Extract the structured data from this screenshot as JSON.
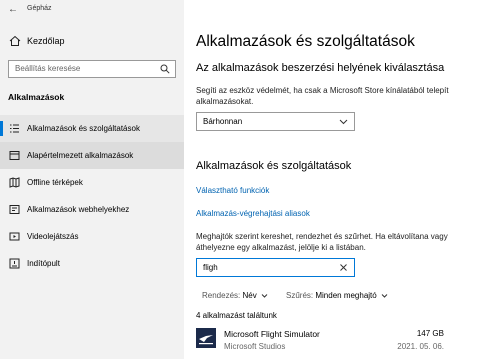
{
  "window": {
    "title": "Gépház"
  },
  "sidebar": {
    "home_label": "Kezdőlap",
    "search_placeholder": "Beállítás keresése",
    "section_label": "Alkalmazások",
    "items": [
      {
        "label": "Alkalmazások és szolgáltatások",
        "icon": "list-icon"
      },
      {
        "label": "Alapértelmezett alkalmazások",
        "icon": "default-apps-icon"
      },
      {
        "label": "Offline térképek",
        "icon": "map-icon"
      },
      {
        "label": "Alkalmazások webhelyekhez",
        "icon": "website-icon"
      },
      {
        "label": "Videolejátszás",
        "icon": "video-icon"
      },
      {
        "label": "Indítópult",
        "icon": "startup-icon"
      }
    ]
  },
  "main": {
    "title": "Alkalmazások és szolgáltatások",
    "install_heading": "Az alkalmazások beszerzési helyének kiválasztása",
    "install_desc": "Segíti az eszköz védelmét, ha csak a Microsoft Store kínálatából telepít alkalmazásokat.",
    "install_dropdown_value": "Bárhonnan",
    "apps_heading": "Alkalmazások és szolgáltatások",
    "link_optional": "Választható funkciók",
    "link_aliases": "Alkalmazás-végrehajtási aliasok",
    "apps_desc": "Meghajtók szerint kereshet, rendezhet és szűrhet. Ha eltávolítana vagy áthelyezne egy alkalmazást, jelölje ki a listában.",
    "filter_value": "fligh",
    "sort_label": "Rendezés:",
    "sort_value": "Név",
    "filter_label": "Szűrés:",
    "filter_drive_value": "Minden meghajtó",
    "found_count": "4 alkalmazást találtunk",
    "app": {
      "name": "Microsoft Flight Simulator",
      "publisher": "Microsoft Studios",
      "size": "147 GB",
      "date": "2021. 05. 06."
    }
  },
  "colors": {
    "accent": "#0078d7",
    "link": "#0063b1",
    "sidebar_bg": "#f2f2f2"
  }
}
